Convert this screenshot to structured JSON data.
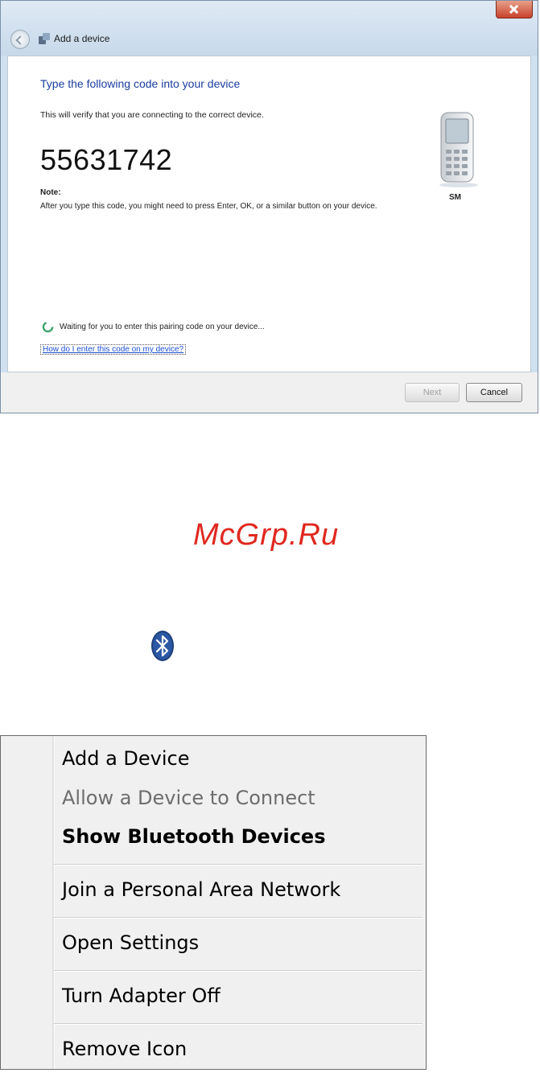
{
  "window": {
    "title": "Add a device",
    "instruction": "Type the following code into your device",
    "verify_text": "This will verify that you are connecting to the correct device.",
    "pairing_code": "55631742",
    "note_heading": "Note:",
    "note_text": "After you type this code, you might need to press Enter, OK, or a similar button on your device.",
    "device_label": "SM",
    "waiting_text": "Waiting for you to enter this pairing code on your device...",
    "help_link": "How do I enter this code on my device?",
    "next_label": "Next",
    "cancel_label": "Cancel"
  },
  "watermark": "McGrp.Ru",
  "menu": {
    "items": [
      {
        "label": "Add a Device"
      },
      {
        "label": "Allow a Device to Connect"
      },
      {
        "label": "Show Bluetooth Devices"
      },
      {
        "label": "Join a Personal Area Network"
      },
      {
        "label": "Open Settings"
      },
      {
        "label": "Turn Adapter Off"
      },
      {
        "label": "Remove Icon"
      }
    ]
  },
  "colors": {
    "instruction": "#1a3d9f",
    "link": "#1c4fd1",
    "watermark": "#e0281f",
    "bluetooth": "#1f3f7a"
  },
  "icons": [
    "close-icon",
    "back-arrow-icon",
    "bluetooth-device-icon",
    "phone-icon",
    "spinner-icon",
    "bluetooth-icon"
  ]
}
